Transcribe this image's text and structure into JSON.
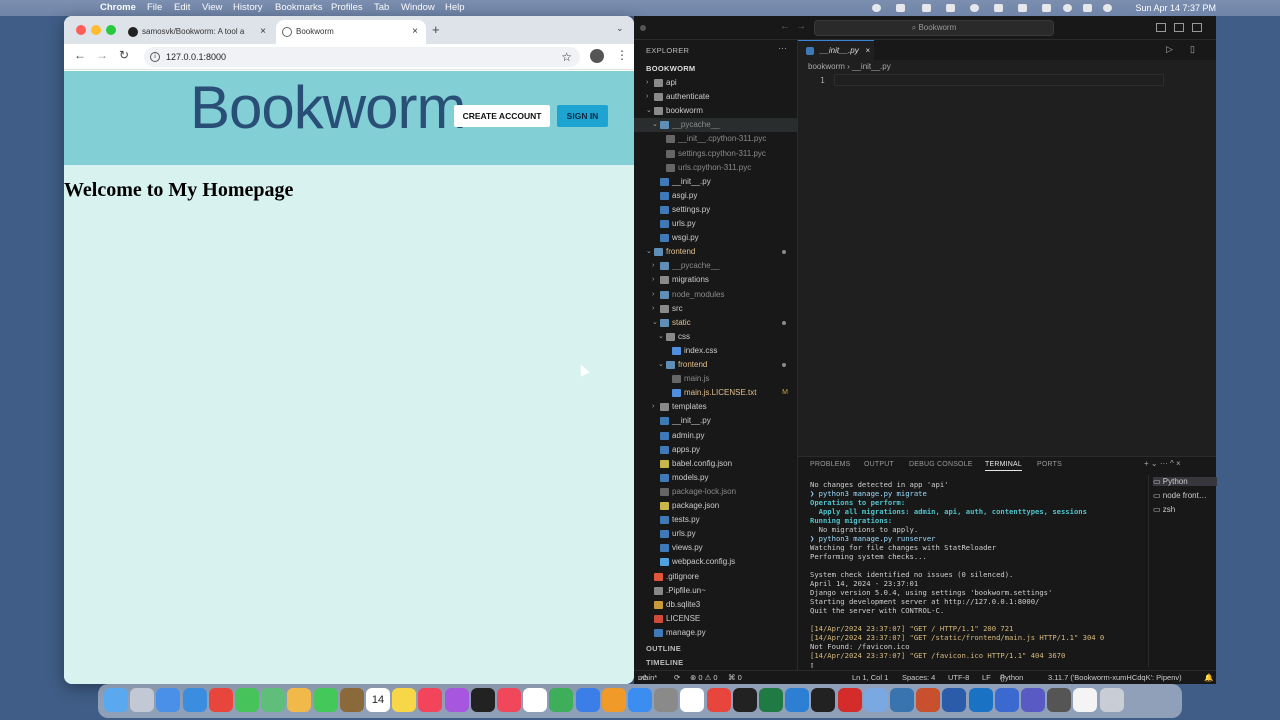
{
  "menubar": {
    "apple_glyph": "",
    "app_name": "Chrome",
    "menus": [
      "File",
      "Edit",
      "View",
      "History",
      "Bookmarks",
      "Profiles",
      "Tab",
      "Window",
      "Help"
    ],
    "clock": "Sun Apr 14  7:37 PM"
  },
  "chrome": {
    "tabs": [
      {
        "title": "samosvk/Bookworm: A tool a",
        "icon": "github-icon",
        "close": "×"
      },
      {
        "title": "Bookworm",
        "icon": "globe-icon",
        "close": "×"
      }
    ],
    "new_tab": "+",
    "url": "127.0.0.1:8000",
    "nav": {
      "back": "←",
      "forward": "→",
      "reload": "↻",
      "star": "☆",
      "menu": "⋮"
    }
  },
  "site": {
    "logo": "Bookworm",
    "create_account": "CREATE ACCOUNT",
    "sign_in": "SIGN IN",
    "heading": "Welcome to My Homepage",
    "header_color": "#82cfd6",
    "body_color": "#d7f2ef"
  },
  "vscode": {
    "search_placeholder": "Bookworm",
    "explorer_title": "EXPLORER",
    "root_title": "BOOKWORM",
    "editor_tab": "__init__.py",
    "breadcrumb": "bookworm  ›  __init__.py",
    "line_number": "1",
    "tree": [
      {
        "label": "api",
        "depth": 1,
        "kind": "folder",
        "chev": "›"
      },
      {
        "label": "authenticate",
        "depth": 1,
        "kind": "folder",
        "chev": "›"
      },
      {
        "label": "bookworm",
        "depth": 1,
        "kind": "folder",
        "chev": "⌄"
      },
      {
        "label": "__pycache__",
        "depth": 2,
        "kind": "folder-dim",
        "chev": "⌄",
        "selected": true
      },
      {
        "label": "__init__.cpython-311.pyc",
        "depth": 3,
        "kind": "file-dim"
      },
      {
        "label": "settings.cpython-311.pyc",
        "depth": 3,
        "kind": "file-dim"
      },
      {
        "label": "urls.cpython-311.pyc",
        "depth": 3,
        "kind": "file-dim"
      },
      {
        "label": "__init__.py",
        "depth": 2,
        "kind": "py"
      },
      {
        "label": "asgi.py",
        "depth": 2,
        "kind": "py"
      },
      {
        "label": "settings.py",
        "depth": 2,
        "kind": "py"
      },
      {
        "label": "urls.py",
        "depth": 2,
        "kind": "py"
      },
      {
        "label": "wsgi.py",
        "depth": 2,
        "kind": "py"
      },
      {
        "label": "frontend",
        "depth": 1,
        "kind": "folder-mod",
        "chev": "⌄",
        "dot": true
      },
      {
        "label": "__pycache__",
        "depth": 2,
        "kind": "folder-dim",
        "chev": "›"
      },
      {
        "label": "migrations",
        "depth": 2,
        "kind": "folder",
        "chev": "›"
      },
      {
        "label": "node_modules",
        "depth": 2,
        "kind": "folder-dim",
        "chev": "›"
      },
      {
        "label": "src",
        "depth": 2,
        "kind": "folder",
        "chev": "›"
      },
      {
        "label": "static",
        "depth": 2,
        "kind": "folder-mod",
        "chev": "⌄",
        "dot": true
      },
      {
        "label": "css",
        "depth": 3,
        "kind": "folder",
        "chev": "⌄"
      },
      {
        "label": "index.css",
        "depth": 4,
        "kind": "css"
      },
      {
        "label": "frontend",
        "depth": 3,
        "kind": "folder-mod",
        "chev": "⌄",
        "dot": true
      },
      {
        "label": "main.js",
        "depth": 4,
        "kind": "file-dim"
      },
      {
        "label": "main.js.LICENSE.txt",
        "depth": 4,
        "kind": "txt-mod",
        "badge": "M"
      },
      {
        "label": "templates",
        "depth": 2,
        "kind": "folder",
        "chev": "›"
      },
      {
        "label": "__init__.py",
        "depth": 2,
        "kind": "py"
      },
      {
        "label": "admin.py",
        "depth": 2,
        "kind": "py"
      },
      {
        "label": "apps.py",
        "depth": 2,
        "kind": "py"
      },
      {
        "label": "babel.config.json",
        "depth": 2,
        "kind": "json"
      },
      {
        "label": "models.py",
        "depth": 2,
        "kind": "py"
      },
      {
        "label": "package-lock.json",
        "depth": 2,
        "kind": "file-dim"
      },
      {
        "label": "package.json",
        "depth": 2,
        "kind": "json"
      },
      {
        "label": "tests.py",
        "depth": 2,
        "kind": "py"
      },
      {
        "label": "urls.py",
        "depth": 2,
        "kind": "py"
      },
      {
        "label": "views.py",
        "depth": 2,
        "kind": "py"
      },
      {
        "label": "webpack.config.js",
        "depth": 2,
        "kind": "js"
      },
      {
        "label": ".gitignore",
        "depth": 1,
        "kind": "git"
      },
      {
        "label": ".Pipfile.un~",
        "depth": 1,
        "kind": "file"
      },
      {
        "label": "db.sqlite3",
        "depth": 1,
        "kind": "db"
      },
      {
        "label": "LICENSE",
        "depth": 1,
        "kind": "license"
      },
      {
        "label": "manage.py",
        "depth": 1,
        "kind": "py"
      }
    ],
    "outline": "OUTLINE",
    "timeline": "TIMELINE",
    "panel_tabs": [
      "PROBLEMS",
      "OUTPUT",
      "DEBUG CONSOLE",
      "TERMINAL",
      "PORTS"
    ],
    "active_panel_tab": "TERMINAL",
    "terminal_lines": [
      "No changes detected in app 'api'",
      "❯ python3 manage.py migrate",
      "Operations to perform:",
      "  Apply all migrations: admin, api, auth, contenttypes, sessions",
      "Running migrations:",
      "  No migrations to apply.",
      "❯ python3 manage.py runserver",
      "Watching for file changes with StatReloader",
      "Performing system checks...",
      "",
      "System check identified no issues (0 silenced).",
      "April 14, 2024 - 23:37:01",
      "Django version 5.0.4, using settings 'bookworm.settings'",
      "Starting development server at http://127.0.0.1:8000/",
      "Quit the server with CONTROL-C.",
      "",
      "[14/Apr/2024 23:37:07] \"GET / HTTP/1.1\" 200 721",
      "[14/Apr/2024 23:37:07] \"GET /static/frontend/main.js HTTP/1.1\" 304 0",
      "Not Found: /favicon.ico",
      "[14/Apr/2024 23:37:07] \"GET /favicon.ico HTTP/1.1\" 404 3670",
      "▯"
    ],
    "terminals": [
      {
        "label": "Python",
        "selected": true
      },
      {
        "label": "node  front…",
        "selected": false
      },
      {
        "label": "zsh",
        "selected": false
      }
    ],
    "panel_actions": "+ ⌄  ···  ^  ×",
    "status": {
      "branch": "main*",
      "sync": "⟳",
      "problems": "⊗ 0 ⚠ 0",
      "ports": "⌘ 0",
      "position": "Ln 1, Col 1",
      "spaces": "Spaces: 4",
      "encoding": "UTF-8",
      "eol": "LF",
      "language": "Python",
      "interpreter": "3.11.7 ('Bookworm-xumHCdqK': Pipenv)",
      "bell": "🔔"
    }
  },
  "dock": {
    "apps": [
      "finder",
      "launchpad",
      "mail",
      "safari",
      "chrome",
      "facetime",
      "maps",
      "photos",
      "messages",
      "notes-brown",
      "calendar",
      "notes",
      "music",
      "podcasts",
      "tv",
      "news",
      "reminders",
      "numbers",
      "keynote",
      "pages",
      "app-store",
      "settings",
      "notebook",
      "chrome-2",
      "terminal",
      "excel",
      "vscode",
      "terminal-2",
      "acrobat",
      "preview",
      "python",
      "powerpoint",
      "word",
      "outlook",
      "remote",
      "teams",
      "quicktime",
      "notes-white",
      "trash"
    ],
    "calendar_day": "14"
  }
}
